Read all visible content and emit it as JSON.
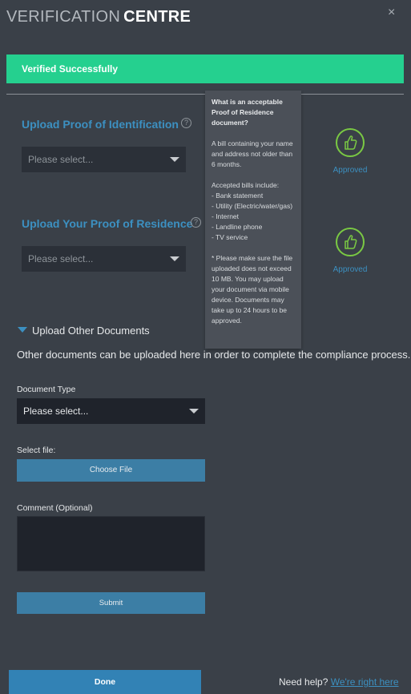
{
  "header": {
    "title_light": "VERIFICATION",
    "title_bold": "CENTRE",
    "close_glyph": "×"
  },
  "banner": {
    "text": "Verified Successfully",
    "color": "#25d08f"
  },
  "identification": {
    "title": "Upload Proof of Identification",
    "select_value": "Please select...",
    "status": "Approved"
  },
  "residence": {
    "title": "Upload Your Proof of Residence",
    "select_value": "Please select...",
    "status": "Approved"
  },
  "tooltip": {
    "heading": "What is an acceptable Proof of Residence document?",
    "body": "A bill containing your name and address not older than 6 months.\n\nAccepted bills include:\n- Bank statement\n- Utility (Electric/water/gas)\n- Internet\n- Landline phone\n- TV service\n\n* Please make sure the file uploaded does not exceed 10 MB. You may upload your document via mobile device. Documents may take up to 24 hours to be approved."
  },
  "other": {
    "heading": "Upload Other Documents",
    "description": "Other documents can be uploaded here in order to complete the compliance process.",
    "doc_type_label": "Document Type",
    "doc_type_value": "Please select...",
    "file_label": "Select file:",
    "file_button": "Choose File",
    "comment_label": "Comment (Optional)",
    "submit": "Submit"
  },
  "footer": {
    "done": "Done",
    "help_text": "Need help?",
    "help_link": "We're right here"
  },
  "icons": [
    "close-icon",
    "help-icon",
    "thumbs-up-icon",
    "chevron-down-icon",
    "triangle-down-icon"
  ],
  "colors": {
    "accent": "#3c90c1",
    "approved": "#7ac943",
    "background": "#3a4048"
  }
}
